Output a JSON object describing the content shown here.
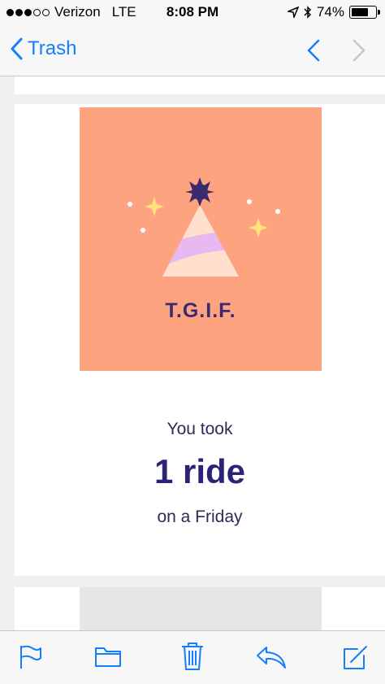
{
  "status_bar": {
    "carrier": "Verizon",
    "network": "LTE",
    "time": "8:08 PM",
    "battery": "74%",
    "battery_level": 0.74,
    "signal_bars": 3,
    "signal_total": 5
  },
  "nav": {
    "back_label": "Trash"
  },
  "email": {
    "hero_title": "T.G.I.F.",
    "line_1": "You took",
    "line_2": "1 ride",
    "line_3": "on a Friday"
  },
  "colors": {
    "accent": "#157efb",
    "hero_bg": "#fea380",
    "hat_purple": "#e8b8f0",
    "hat_cream": "#ffe0cf",
    "pom_pom": "#3a2b6f",
    "sparkle": "#ffe27a",
    "text_dark": "#2b2377"
  },
  "icons": {
    "back": "chevron-left-icon",
    "prev": "chevron-up-icon",
    "next": "chevron-down-icon",
    "toolbar": [
      "flag-icon",
      "folder-icon",
      "trash-icon",
      "reply-icon",
      "compose-icon"
    ]
  }
}
